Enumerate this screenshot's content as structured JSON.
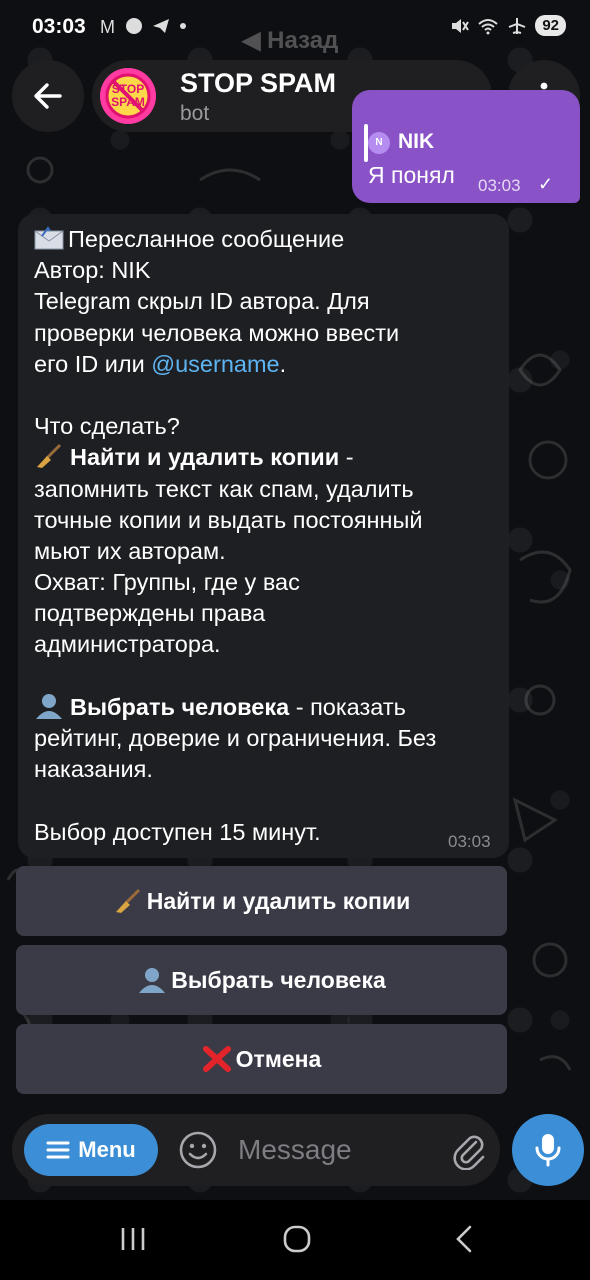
{
  "status_bar": {
    "time": "03:03",
    "left_icons": "M",
    "battery": "92"
  },
  "back_hint": "Назад",
  "header": {
    "title": "STOP SPAM",
    "subtitle": "bot",
    "avatar_text_top": "STOP",
    "avatar_text_bottom": "SPAM"
  },
  "outgoing_message": {
    "reply_avatar_initial": "N",
    "reply_name": "NIK",
    "text": "Я понял",
    "time": "03:03"
  },
  "bot_message": {
    "line1": "Пересланное сообщение",
    "line2": "Автор: NIK",
    "line3": "Telegram скрыл ID автора. Для",
    "line4": "проверки человека можно ввести",
    "line5_prefix": "его ID или ",
    "line5_link": "@username",
    "line5_suffix": ".",
    "q_line": "Что сделать?",
    "option1_bold": "Найти и удалить копии",
    "option1_tail": " -",
    "option1_line2": "запомнить текст как спам, удалить",
    "option1_line3": "точные копии и выдать постоянный",
    "option1_line4": "мьют их авторам.",
    "scope_line1": "Охват: Группы, где у вас",
    "scope_line2": "подтверждены права",
    "scope_line3": "администратора.",
    "option2_bold": "Выбрать человека",
    "option2_tail": " - показать",
    "option2_line2": "рейтинг, доверие и ограничения. Без",
    "option2_line3": "наказания.",
    "footer": "Выбор доступен 15 минут.",
    "time": "03:03"
  },
  "keyboard": {
    "find_delete": "Найти и удалить копии",
    "choose_person": "Выбрать человека",
    "cancel": "Отмена"
  },
  "composer": {
    "menu_label": "Menu",
    "placeholder": "Message"
  },
  "colors": {
    "accent": "#3c8fd6",
    "outgoing_bubble": "#8a52c7",
    "incoming_bubble": "#1e1f22",
    "link": "#5eb4f3",
    "keyboard_button": "#3a3b46"
  }
}
